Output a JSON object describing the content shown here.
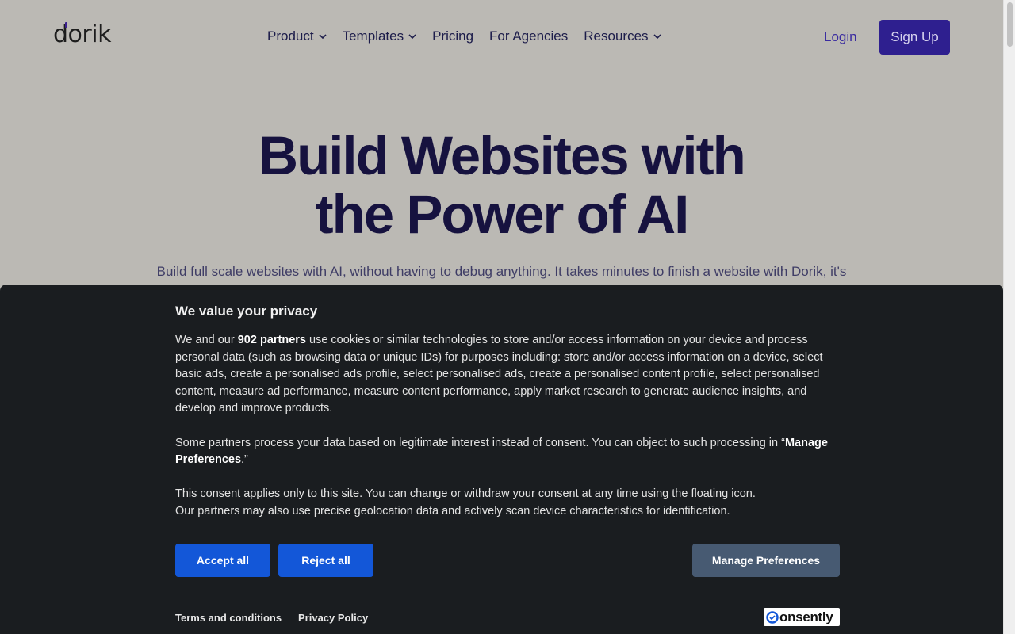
{
  "header": {
    "logo_text": "dorik",
    "nav": [
      {
        "label": "Product",
        "has_dropdown": true
      },
      {
        "label": "Templates",
        "has_dropdown": true
      },
      {
        "label": "Pricing",
        "has_dropdown": false
      },
      {
        "label": "For Agencies",
        "has_dropdown": false
      },
      {
        "label": "Resources",
        "has_dropdown": true
      }
    ],
    "login_label": "Login",
    "signup_label": "Sign Up"
  },
  "hero": {
    "title_line1": "Build Websites with",
    "title_line2": "the Power of AI",
    "subtitle": "Build full scale websites with AI, without having to debug anything. It takes minutes to finish a website with Dorik, it's"
  },
  "consent": {
    "title": "We value your privacy",
    "p1_prefix": "We and our ",
    "p1_bold": "902 partners",
    "p1_rest": " use cookies or similar technologies to store and/or access information on your device and process personal data (such as browsing data or unique IDs) for purposes including: store and/or access information on a device, select basic ads, create a personalised ads profile, select personalised ads, create a personalised content profile, select personalised content, measure ad performance, measure content performance, apply market research to generate audience insights, and develop and improve products.",
    "p2_prefix": "Some partners process your data based on legitimate interest instead of consent. You can object to such processing in “",
    "p2_bold": "Manage Preferences",
    "p2_suffix": ".”",
    "p3_line1": "This consent applies only to this site. You can change or withdraw your consent at any time using the floating icon.",
    "p3_line2": "Our partners may also use precise geolocation data and actively scan device characteristics for identification.",
    "accept_label": "Accept all",
    "reject_label": "Reject all",
    "manage_label": "Manage Preferences",
    "terms_label": "Terms and conditions",
    "privacy_label": "Privacy Policy",
    "brand_label": "onsently"
  },
  "colors": {
    "primary_button": "#1357d8",
    "manage_button": "#475a72",
    "signup": "#2e1f8f",
    "consent_bg": "#1a1d20"
  }
}
